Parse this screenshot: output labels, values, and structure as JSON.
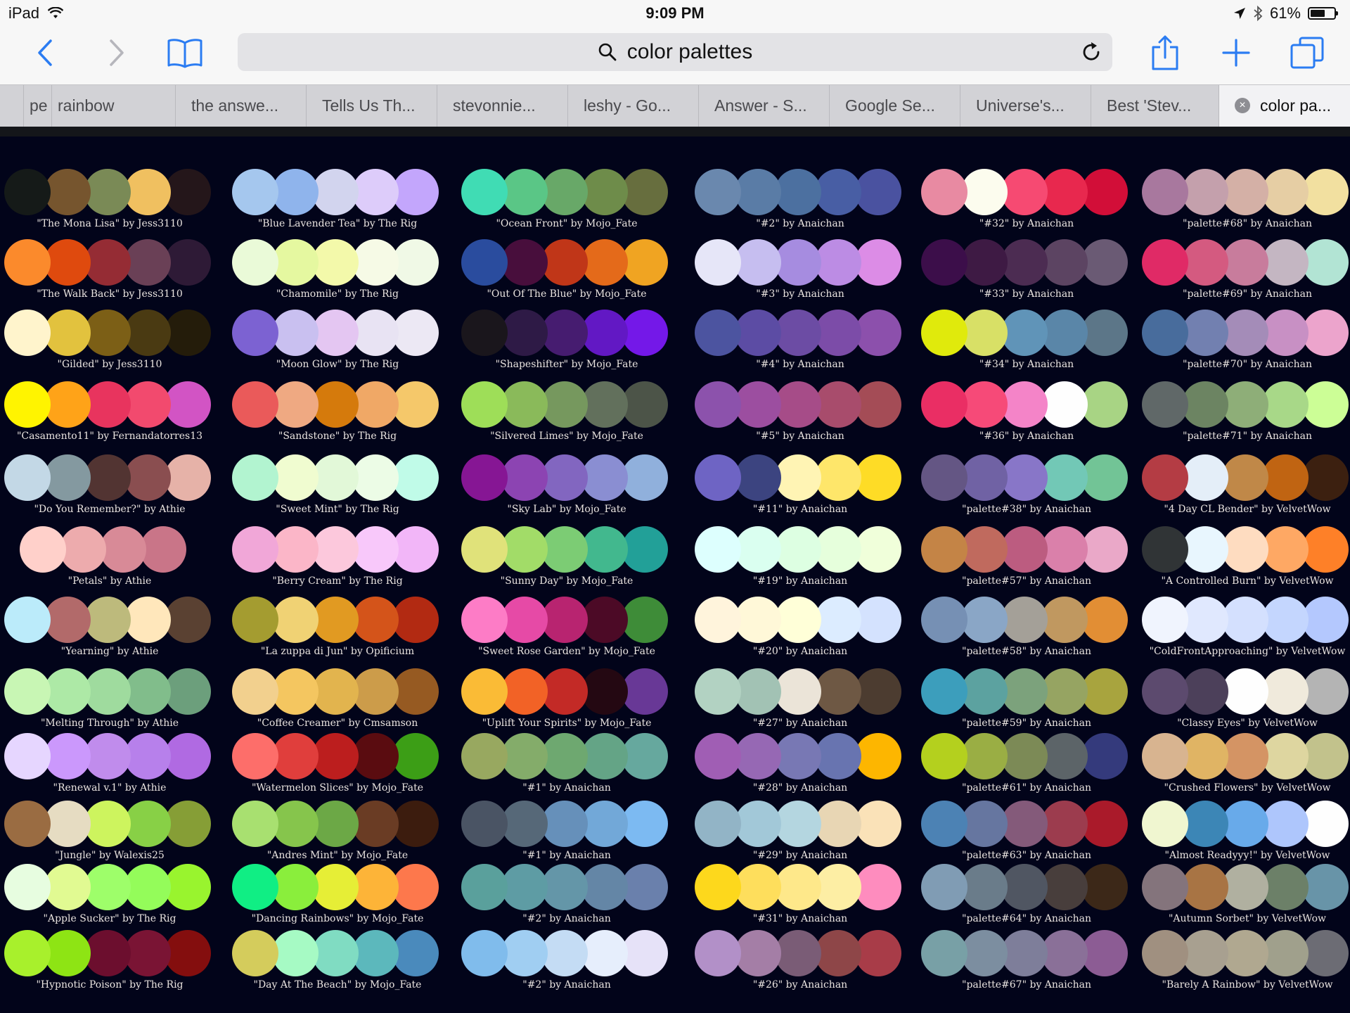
{
  "status_bar": {
    "device": "iPad",
    "time": "9:09 PM",
    "battery": "61%",
    "battery_level": 0.61
  },
  "toolbar": {
    "url_text": "color palettes"
  },
  "tabs": [
    {
      "label": ""
    },
    {
      "label": "pe"
    },
    {
      "label": "rainbow"
    },
    {
      "label": "the answe..."
    },
    {
      "label": "Tells Us Th..."
    },
    {
      "label": "stevonnie..."
    },
    {
      "label": "leshy - Go..."
    },
    {
      "label": "Answer - S..."
    },
    {
      "label": "Google Se..."
    },
    {
      "label": "Universe's..."
    },
    {
      "label": "Best 'Stev..."
    },
    {
      "label": "color pa...",
      "active": true
    }
  ],
  "palettes": [
    [
      {
        "label": "\"The Mona Lisa\" by Jess3110",
        "colors": [
          "#151a18",
          "#76552e",
          "#7a8a56",
          "#f0c060",
          "#24161a"
        ]
      },
      {
        "label": "\"The Walk Back\" by Jess3110",
        "colors": [
          "#fb8a2c",
          "#df4a0e",
          "#952c34",
          "#6a4056",
          "#2e1a36"
        ]
      },
      {
        "label": "\"Gilded\" by Jess3110",
        "colors": [
          "#fff4cc",
          "#e2c23e",
          "#7c5f16",
          "#4a3a12",
          "#241c0a"
        ]
      },
      {
        "label": "\"Casamento11\" by Fernandatorres13",
        "colors": [
          "#fff400",
          "#ffa318",
          "#e8345e",
          "#f24a6e",
          "#d254c4"
        ]
      },
      {
        "label": "\"Do You Remember?\" by Athie",
        "colors": [
          "#c3d8e6",
          "#8499a0",
          "#523432",
          "#8a4e50",
          "#e6b2a8"
        ]
      },
      {
        "label": "\"Petals\" by Athie",
        "colors": [
          "#ffd0ca",
          "#edabad",
          "#d88a97",
          "#c97588"
        ]
      },
      {
        "label": "\"Yearning\" by Athie",
        "colors": [
          "#bbebfa",
          "#b26a6a",
          "#bdba7c",
          "#ffe7bb",
          "#5a4132"
        ]
      },
      {
        "label": "\"Melting Through\" by Athie",
        "colors": [
          "#c8f6b4",
          "#ade9a6",
          "#9fdb9e",
          "#81bd8b",
          "#6c9f7c"
        ]
      },
      {
        "label": "\"Renewal v.1\" by Athie",
        "colors": [
          "#e6d6ff",
          "#cb98fc",
          "#c08cec",
          "#b780eb",
          "#b06ae2"
        ]
      },
      {
        "label": "\"Jungle\" by Walexis25",
        "colors": [
          "#9a6c42",
          "#e6dcc2",
          "#cdf45e",
          "#88d046",
          "#869e36"
        ]
      },
      {
        "label": "\"Apple Sucker\" by The Rig",
        "colors": [
          "#e7fde0",
          "#e1fa92",
          "#9efe6a",
          "#94fc5a",
          "#99f42e"
        ]
      },
      {
        "label": "\"Hypnotic Poison\" by The Rig",
        "colors": [
          "#a8f02c",
          "#8ee414",
          "#6c0e2e",
          "#7a1434",
          "#840e0e"
        ]
      }
    ],
    [
      {
        "label": "\"Blue Lavender Tea\" by The Rig",
        "colors": [
          "#a5c7ee",
          "#8fb4ec",
          "#d2d4ee",
          "#ddccfa",
          "#c3a6fc"
        ]
      },
      {
        "label": "\"Chamomile\" by The Rig",
        "colors": [
          "#eafad8",
          "#e5f8a0",
          "#f3f9aa",
          "#f6fae6",
          "#f0f9e6"
        ]
      },
      {
        "label": "\"Moon Glow\" by The Rig",
        "colors": [
          "#7c62d2",
          "#c9c0f0",
          "#e4c6f2",
          "#e8e3f3",
          "#ece8f4"
        ]
      },
      {
        "label": "\"Sandstone\" by The Rig",
        "colors": [
          "#ea5a5a",
          "#efa982",
          "#d57a0c",
          "#f0a866",
          "#f5c86a"
        ]
      },
      {
        "label": "\"Sweet Mint\" by The Rig",
        "colors": [
          "#b2f4d0",
          "#f0fcd0",
          "#e2f8d8",
          "#ecfce6",
          "#c0fbe8"
        ]
      },
      {
        "label": "\"Berry Cream\" by The Rig",
        "colors": [
          "#f1a7d8",
          "#fbb6c8",
          "#fcc8dc",
          "#f8c8fa",
          "#f2b6f8"
        ]
      },
      {
        "label": "\"La zuppa di Jun\" by Opificium",
        "colors": [
          "#a49c30",
          "#f0d274",
          "#e19a22",
          "#d4541a",
          "#b22a12"
        ]
      },
      {
        "label": "\"Coffee Creamer\" by Cmsamson",
        "colors": [
          "#f2d08e",
          "#f4c660",
          "#e2b44e",
          "#cc9c4a",
          "#965a22"
        ]
      },
      {
        "label": "\"Watermelon Slices\" by Mojo_Fate",
        "colors": [
          "#fd6e6a",
          "#e03e3c",
          "#bc1e1e",
          "#5a0c10",
          "#3c9e16"
        ]
      },
      {
        "label": "\"Andres Mint\" by Mojo_Fate",
        "colors": [
          "#a8e070",
          "#86c54c",
          "#6ca846",
          "#6a3c24",
          "#3c1c0e"
        ]
      },
      {
        "label": "\"Dancing Rainbows\" by Mojo_Fate",
        "colors": [
          "#10ee84",
          "#8aee3c",
          "#e6ee36",
          "#fdb438",
          "#fd784c"
        ]
      },
      {
        "label": "\"Day At The Beach\" by Mojo_Fate",
        "colors": [
          "#d4cc5c",
          "#a6fac4",
          "#80dcc2",
          "#5cb8bc",
          "#4a8abc"
        ]
      }
    ],
    [
      {
        "label": "\"Ocean Front\" by Mojo_Fate",
        "colors": [
          "#40dcb4",
          "#5ac686",
          "#68a868",
          "#6e8c4a",
          "#676e3e"
        ]
      },
      {
        "label": "\"Out Of The Blue\" by Mojo_Fate",
        "colors": [
          "#2a4c9e",
          "#480e3c",
          "#c03618",
          "#e46a1a",
          "#f0a422"
        ]
      },
      {
        "label": "\"Shapeshifter\" by Mojo_Fate",
        "colors": [
          "#1a161c",
          "#2e1a46",
          "#461c70",
          "#6218c4",
          "#7418e8"
        ]
      },
      {
        "label": "\"Silvered Limes\" by Mojo_Fate",
        "colors": [
          "#9ede58",
          "#8aba5a",
          "#76985e",
          "#62705c",
          "#4c5448"
        ]
      },
      {
        "label": "\"Sky Lab\" by Mojo_Fate",
        "colors": [
          "#861694",
          "#8c44b2",
          "#8266c0",
          "#8a8ed2",
          "#90b0dc"
        ]
      },
      {
        "label": "\"Sunny Day\" by Mojo_Fate",
        "colors": [
          "#e0e27a",
          "#a2dc68",
          "#7ccc74",
          "#42b88e",
          "#22a098"
        ]
      },
      {
        "label": "\"Sweet Rose Garden\" by Mojo_Fate",
        "colors": [
          "#fd7cc6",
          "#e64aa6",
          "#b82470",
          "#4c0a26",
          "#3e8c38"
        ]
      },
      {
        "label": "\"Uplift Your Spirits\" by Mojo_Fate",
        "colors": [
          "#fabb36",
          "#f26226",
          "#c32a26",
          "#240812",
          "#683896"
        ]
      },
      {
        "label": "\"#1\" by Anaichan",
        "colors": [
          "#98a860",
          "#84ac6a",
          "#6ea870",
          "#64a486",
          "#66a89e"
        ]
      },
      {
        "label": "\"#1\" by Anaichan",
        "colors": [
          "#4a5464",
          "#566878",
          "#6690ba",
          "#72a8d8",
          "#7cbaf2"
        ]
      },
      {
        "label": "\"#2\" by Anaichan",
        "colors": [
          "#5aa09c",
          "#5e9ca4",
          "#6496a8",
          "#6486a6",
          "#6a80ac"
        ]
      },
      {
        "label": "\"#2\" by Anaichan",
        "colors": [
          "#80bcec",
          "#a0cef2",
          "#c4dcf4",
          "#e6eefc",
          "#e6e2f8"
        ]
      }
    ],
    [
      {
        "label": "\"#2\" by Anaichan",
        "colors": [
          "#6a88ae",
          "#5a7ca6",
          "#4c70a0",
          "#485ea4",
          "#4a52a0"
        ]
      },
      {
        "label": "\"#3\" by Anaichan",
        "colors": [
          "#e6e6f8",
          "#c6bef0",
          "#a68ce0",
          "#bc8ce4",
          "#dc8ce6"
        ]
      },
      {
        "label": "\"#4\" by Anaichan",
        "colors": [
          "#4c54a0",
          "#5c4ca4",
          "#6c4ca4",
          "#7c4ca8",
          "#8c50ac"
        ]
      },
      {
        "label": "\"#5\" by Anaichan",
        "colors": [
          "#8c52ac",
          "#9c4ea0",
          "#a64c88",
          "#a84c6c",
          "#a44c56"
        ]
      },
      {
        "label": "\"#11\" by Anaichan",
        "colors": [
          "#6e64c4",
          "#3c4480",
          "#fff4b4",
          "#fee66a",
          "#fedc26"
        ]
      },
      {
        "label": "\"#19\" by Anaichan",
        "colors": [
          "#ddfffe",
          "#dafff0",
          "#ddffe2",
          "#e6ffdc",
          "#f0ffda"
        ]
      },
      {
        "label": "\"#20\" by Anaichan",
        "colors": [
          "#fff4dc",
          "#fff8d8",
          "#ffffd8",
          "#dcecff",
          "#d4e2fe"
        ]
      },
      {
        "label": "\"#27\" by Anaichan",
        "colors": [
          "#b2d2c2",
          "#a2c2b4",
          "#ebe4d8",
          "#6e5844",
          "#4c3c30"
        ]
      },
      {
        "label": "\"#28\" by Anaichan",
        "colors": [
          "#a05eb4",
          "#9668b4",
          "#7878b4",
          "#6874b0",
          "#fdb600"
        ]
      },
      {
        "label": "\"#29\" by Anaichan",
        "colors": [
          "#92b4c6",
          "#a2c8d8",
          "#b4d6e0",
          "#e8d6b4",
          "#fae2b8"
        ]
      },
      {
        "label": "\"#31\" by Anaichan",
        "colors": [
          "#fdd81c",
          "#fede5c",
          "#fee88a",
          "#fdeea4",
          "#fe8cbe"
        ]
      },
      {
        "label": "\"#26\" by Anaichan",
        "colors": [
          "#b290c8",
          "#a47ea6",
          "#7a5c76",
          "#8e4648",
          "#a83c48"
        ]
      }
    ],
    [
      {
        "label": "\"#32\" by Anaichan",
        "colors": [
          "#e88aa2",
          "#fcfcee",
          "#f64a72",
          "#e8284e",
          "#d20e38"
        ]
      },
      {
        "label": "\"#33\" by Anaichan",
        "colors": [
          "#3c0e4a",
          "#3e1a44",
          "#4c2c52",
          "#5c4462",
          "#6a5a74"
        ]
      },
      {
        "label": "\"#34\" by Anaichan",
        "colors": [
          "#e0ea0c",
          "#d8e066",
          "#6094b8",
          "#5a86a8",
          "#5c7688"
        ]
      },
      {
        "label": "\"#36\" by Anaichan",
        "colors": [
          "#ea2e64",
          "#f64a78",
          "#f484c8",
          "#fefefe",
          "#a8d484"
        ]
      },
      {
        "label": "\"palette#38\" by Anaichan",
        "colors": [
          "#645684",
          "#7062a4",
          "#8876c8",
          "#72c8b6",
          "#72c496"
        ]
      },
      {
        "label": "\"palette#57\" by Anaichan",
        "colors": [
          "#c48446",
          "#c06a5e",
          "#bc5c80",
          "#da80aa",
          "#eaa8c8"
        ]
      },
      {
        "label": "\"palette#58\" by Anaichan",
        "colors": [
          "#7690b4",
          "#8aa6c6",
          "#a4a098",
          "#c09860",
          "#e28e34"
        ]
      },
      {
        "label": "\"palette#59\" by Anaichan",
        "colors": [
          "#3c9ebc",
          "#5ca2a0",
          "#7ca27c",
          "#96a462",
          "#a8a43e"
        ]
      },
      {
        "label": "\"palette#61\" by Anaichan",
        "colors": [
          "#b4d01e",
          "#9aae44",
          "#7c8a56",
          "#5c6468",
          "#343a7c"
        ]
      },
      {
        "label": "\"palette#63\" by Anaichan",
        "colors": [
          "#4c82b4",
          "#6676a0",
          "#845a7a",
          "#9c3c4e",
          "#aa1a2a"
        ]
      },
      {
        "label": "\"palette#64\" by Anaichan",
        "colors": [
          "#809cb4",
          "#6a7c8a",
          "#505662",
          "#483e3c",
          "#3c2818"
        ]
      },
      {
        "label": "\"palette#67\" by Anaichan",
        "colors": [
          "#78a0a6",
          "#7c8ea0",
          "#7e7e9a",
          "#8a7098",
          "#8c5c94"
        ]
      }
    ],
    [
      {
        "label": "\"palette#68\" by Anaichan",
        "colors": [
          "#a8789e",
          "#c4a0ac",
          "#d4b0a6",
          "#e6cea4",
          "#f2e0a0"
        ]
      },
      {
        "label": "\"palette#69\" by Anaichan",
        "colors": [
          "#e02a66",
          "#d45a80",
          "#c87c9c",
          "#c4b6c2",
          "#b2e4d4"
        ]
      },
      {
        "label": "\"palette#70\" by Anaichan",
        "colors": [
          "#486c9c",
          "#7280b0",
          "#a48cb8",
          "#c890c4",
          "#eca4cc"
        ]
      },
      {
        "label": "\"palette#71\" by Anaichan",
        "colors": [
          "#606868",
          "#6c8462",
          "#8eae78",
          "#a8d888",
          "#ccfe96"
        ]
      },
      {
        "label": "\"4 Day CL Bender\" by VelvetWow",
        "colors": [
          "#b43c44",
          "#e4eef8",
          "#c08848",
          "#c06412",
          "#3c2010"
        ]
      },
      {
        "label": "\"A Controlled Burn\" by VelvetWow",
        "colors": [
          "#303436",
          "#e8f6fe",
          "#fedcc0",
          "#fea864",
          "#fe8028"
        ]
      },
      {
        "label": "\"ColdFrontApproaching\" by VelvetWow",
        "colors": [
          "#f0f4fe",
          "#e0e8fe",
          "#d4e0fe",
          "#c4d6fe",
          "#b4c8fe"
        ]
      },
      {
        "label": "\"Classy Eyes\" by VelvetWow",
        "colors": [
          "#5c4a6e",
          "#4c405a",
          "#fefefe",
          "#f0eadc",
          "#b4b4b4"
        ]
      },
      {
        "label": "\"Crushed Flowers\" by VelvetWow",
        "colors": [
          "#d8b490",
          "#e0b464",
          "#d49464",
          "#ded6a0",
          "#c2c28c"
        ]
      },
      {
        "label": "\"Almost Readyyy!\" by VelvetWow",
        "colors": [
          "#f0f6d0",
          "#3c86b6",
          "#68aaea",
          "#aec6fc",
          "#fefefe"
        ]
      },
      {
        "label": "\"Autumn Sorbet\" by VelvetWow",
        "colors": [
          "#84747c",
          "#a87444",
          "#b0b0a0",
          "#6c8068",
          "#6894a8"
        ]
      },
      {
        "label": "\"Barely A Rainbow\" by VelvetWow",
        "colors": [
          "#a09080",
          "#a8a090",
          "#b0a890",
          "#a0a08c",
          "#6c6c74"
        ]
      }
    ]
  ]
}
